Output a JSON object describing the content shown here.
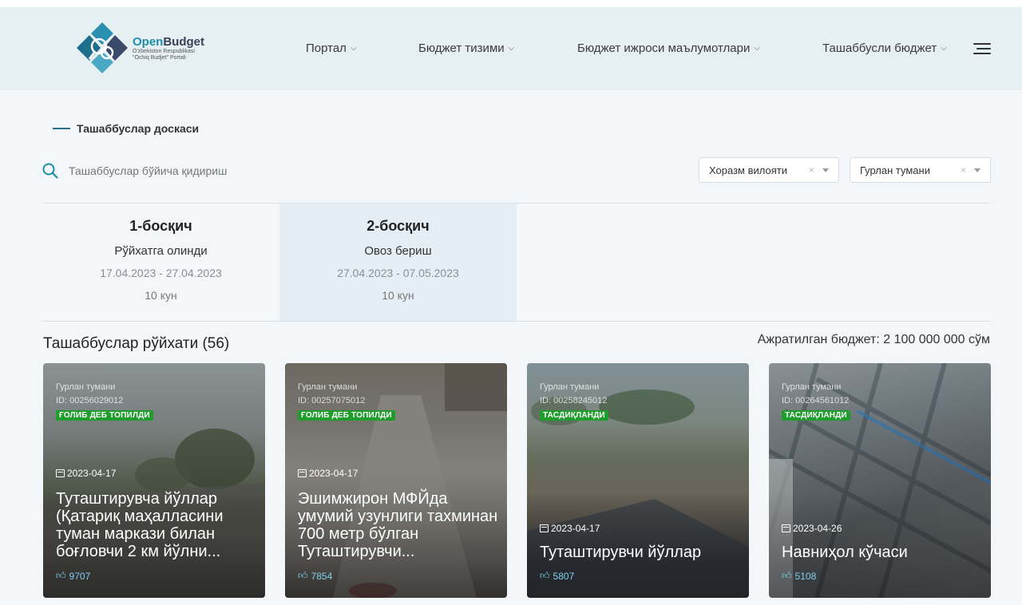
{
  "header": {
    "logo": {
      "title_a": "Open",
      "title_b": "Budget",
      "sub1": "O'zbekiston Respublikasi",
      "sub2": "\"Ochiq Budjet\" Portali"
    },
    "nav": [
      {
        "label": "Портал"
      },
      {
        "label": "Бюджет тизими"
      },
      {
        "label": "Бюджет ижроси маълумотлари"
      },
      {
        "label": "Ташаббусли бюджет"
      }
    ]
  },
  "breadcrumb": "Ташаббуслар доскаси",
  "search": {
    "placeholder": "Ташаббуслар бўйича қидириш",
    "value": ""
  },
  "filters": {
    "region": "Хоразм вилояти",
    "district": "Гурлан тумани",
    "clear_symbol": "×"
  },
  "stages": [
    {
      "title": "1-босқич",
      "name": "Рўйхатга олинди",
      "dates": "17.04.2023 - 27.04.2023",
      "days": "10 кун",
      "active": false
    },
    {
      "title": "2-босқич",
      "name": "Овоз бериш",
      "dates": "27.04.2023 - 07.05.2023",
      "days": "10 кун",
      "active": true
    }
  ],
  "list": {
    "title": "Ташаббуслар рўйхати (56)",
    "budget": "Ажратилган бюджет: 2 100 000 000 сўм"
  },
  "cards": [
    {
      "region": "Гурлан тумани",
      "id": "ID: 00256029012",
      "badge": "ҒОЛИБ ДЕБ ТОПИЛДИ",
      "date": "2023-04-17",
      "title": "Туташтирувча йўллар (Қатариқ маҳалласини туман маркази билан боғловчи 2 км йўлни...",
      "votes": "9707",
      "bg": "road"
    },
    {
      "region": "Гурлан тумани",
      "id": "ID: 00257075012",
      "badge": "ҒОЛИБ ДЕБ ТОПИЛДИ",
      "date": "2023-04-17",
      "title": "Эшимжирон МФЙда умумий узунлиги тахминан 700 метр бўлган Туташтирувчи...",
      "votes": "7854",
      "bg": "dirt"
    },
    {
      "region": "Гурлан тумани",
      "id": "ID: 00258245012",
      "badge": "ТАСДИҚЛАНДИ",
      "date": "2023-04-17",
      "title": "Туташтирувчи йўллар",
      "votes": "5807",
      "bg": "street"
    },
    {
      "region": "Гурлан тумани",
      "id": "ID: 00264561012",
      "badge": "ТАСДИҚЛАНДИ",
      "date": "2023-04-26",
      "title": "Навниҳол кўчаси",
      "votes": "5108",
      "bg": "map"
    }
  ]
}
